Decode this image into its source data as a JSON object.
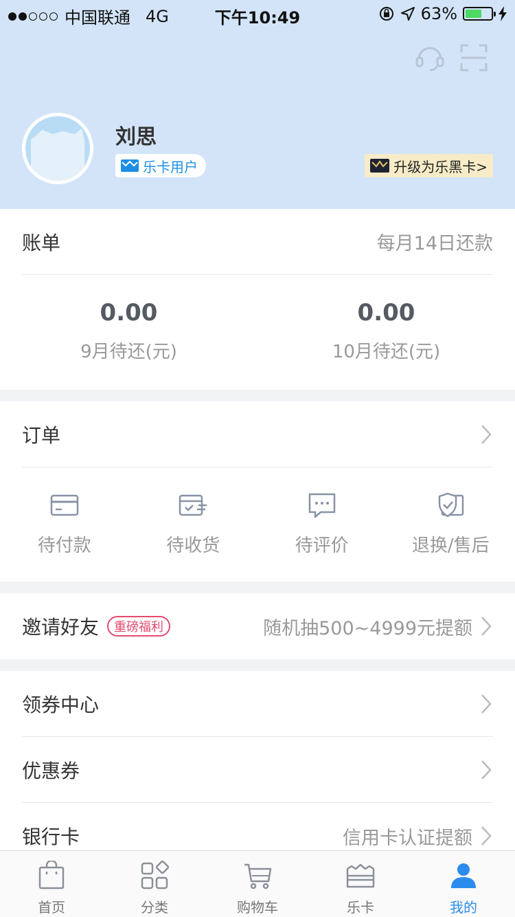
{
  "status_bar": {
    "carrier": "中国联通",
    "network": "4G",
    "time": "下午10:49",
    "battery": "63%",
    "battery_level": 0.63
  },
  "profile": {
    "name": "刘思",
    "badge": "乐卡用户",
    "upgrade": "升级为乐黑卡>"
  },
  "bill": {
    "title": "账单",
    "due_note": "每月14日还款",
    "items": [
      {
        "amount": "0.00",
        "label": "9月待还(元)"
      },
      {
        "amount": "0.00",
        "label": "10月待还(元)"
      }
    ]
  },
  "orders": {
    "title": "订单",
    "items": [
      {
        "label": "待付款",
        "icon": "card-icon"
      },
      {
        "label": "待收货",
        "icon": "delivery-icon"
      },
      {
        "label": "待评价",
        "icon": "comment-icon"
      },
      {
        "label": "退换/售后",
        "icon": "shield-icon"
      }
    ]
  },
  "invite": {
    "title": "邀请好友",
    "tag": "重磅福利",
    "note": "随机抽500~4999元提额"
  },
  "menu": [
    {
      "label": "领券中心",
      "note": ""
    },
    {
      "label": "优惠券",
      "note": ""
    },
    {
      "label": "银行卡",
      "note": "信用卡认证提额"
    }
  ],
  "tabs": [
    {
      "label": "首页",
      "icon": "bag-icon"
    },
    {
      "label": "分类",
      "icon": "category-icon"
    },
    {
      "label": "购物车",
      "icon": "cart-icon"
    },
    {
      "label": "乐卡",
      "icon": "lecard-icon"
    },
    {
      "label": "我的",
      "icon": "user-icon",
      "active": true
    }
  ],
  "colors": {
    "header_bg": "#d3e4f8",
    "accent": "#2b8cee",
    "promo": "#e64a6e",
    "upgrade_bg": "#f7ecc7"
  }
}
